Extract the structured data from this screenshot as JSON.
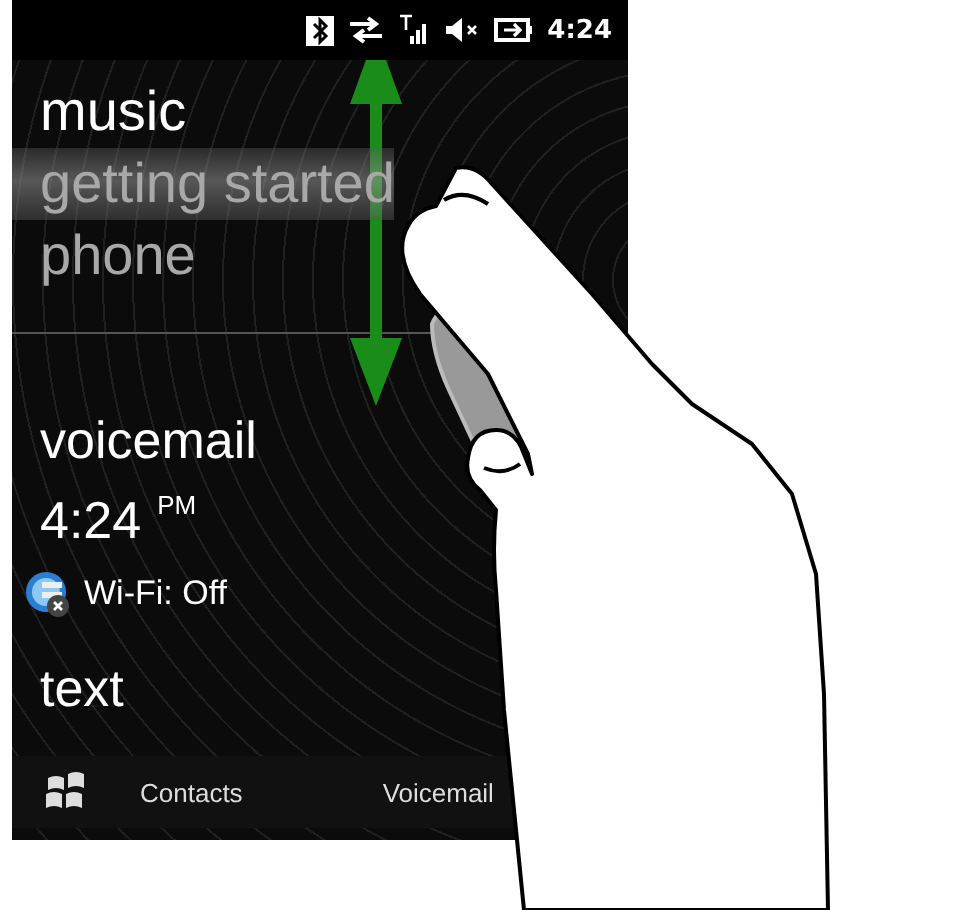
{
  "status_bar": {
    "time": "4:24"
  },
  "menu": [
    {
      "label": "music",
      "selected": false,
      "dimmed": false
    },
    {
      "label": "getting started",
      "selected": true,
      "dimmed": true
    },
    {
      "label": "phone",
      "selected": false,
      "dimmed": true
    }
  ],
  "panel": {
    "title": "voicemail",
    "time": "4:24",
    "time_suffix": "PM",
    "wifi_status": "Wi-Fi: Off",
    "next_title": "text"
  },
  "softkeys": [
    "Contacts",
    "Voicemail"
  ]
}
